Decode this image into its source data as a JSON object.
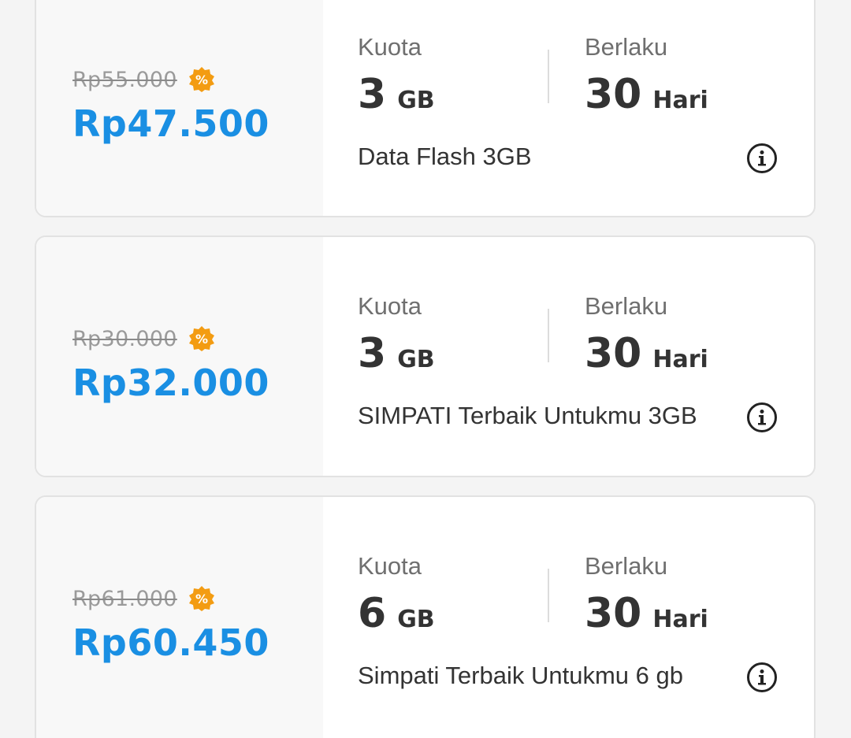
{
  "labels": {
    "quota": "Kuota",
    "validity": "Berlaku"
  },
  "colors": {
    "price_blue": "#1a8fe3",
    "badge_orange": "#f39c12"
  },
  "icons": {
    "promo": "discount-badge-icon",
    "info": "info-icon"
  },
  "packages": [
    {
      "old_price": "Rp55.000",
      "price": "Rp47.500",
      "quota_value": "3",
      "quota_unit": "GB",
      "validity_value": "30",
      "validity_unit": "Hari",
      "name": "Data Flash 3GB"
    },
    {
      "old_price": "Rp30.000",
      "price": "Rp32.000",
      "quota_value": "3",
      "quota_unit": "GB",
      "validity_value": "30",
      "validity_unit": "Hari",
      "name": "SIMPATI Terbaik Untukmu 3GB"
    },
    {
      "old_price": "Rp61.000",
      "price": "Rp60.450",
      "quota_value": "6",
      "quota_unit": "GB",
      "validity_value": "30",
      "validity_unit": "Hari",
      "name": "Simpati Terbaik Untukmu 6 gb"
    }
  ]
}
